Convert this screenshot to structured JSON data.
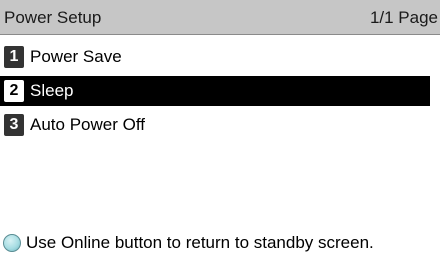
{
  "header": {
    "title": "Power Setup",
    "page_indicator": "1/1 Page"
  },
  "menu": {
    "items": [
      {
        "number": "1",
        "label": "Power Save",
        "selected": false
      },
      {
        "number": "2",
        "label": "Sleep",
        "selected": true
      },
      {
        "number": "3",
        "label": "Auto Power Off",
        "selected": false
      }
    ]
  },
  "footer": {
    "icon": "online-button-icon",
    "message": "Use Online button to return to standby screen."
  },
  "colors": {
    "header_bg": "#c6c6c6",
    "selected_bg": "#000000",
    "badge_bg": "#333333",
    "online_icon": "#a7dde3"
  }
}
